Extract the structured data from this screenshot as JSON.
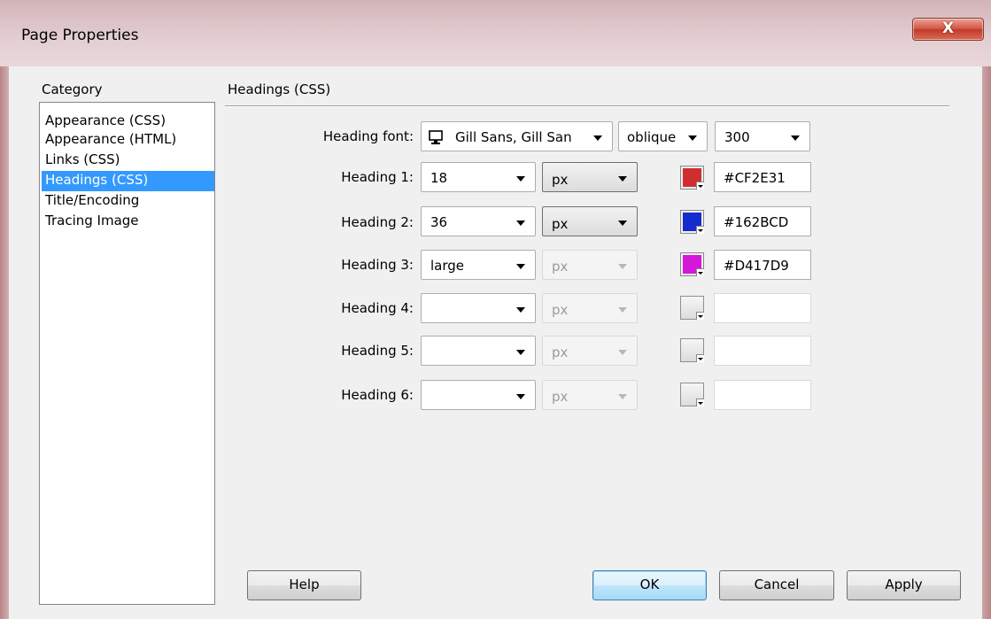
{
  "window": {
    "title": "Page Properties",
    "close_label": "X"
  },
  "category": {
    "label": "Category",
    "items": [
      "Appearance (CSS)",
      "Appearance (HTML)",
      "Links (CSS)",
      "Headings (CSS)",
      "Title/Encoding",
      "Tracing Image"
    ],
    "selected": "Headings (CSS)"
  },
  "section": {
    "title": "Headings (CSS)"
  },
  "heading_font": {
    "label": "Heading font:",
    "font": "Gill Sans, Gill San",
    "style": "oblique",
    "weight": "300"
  },
  "headings": [
    {
      "label": "Heading 1:",
      "size": "18",
      "unit": "px",
      "unit_enabled": true,
      "color": "#CF2E31"
    },
    {
      "label": "Heading 2:",
      "size": "36",
      "unit": "px",
      "unit_enabled": true,
      "color": "#162BCD"
    },
    {
      "label": "Heading 3:",
      "size": "large",
      "unit": "px",
      "unit_enabled": false,
      "color": "#D417D9"
    },
    {
      "label": "Heading 4:",
      "size": "",
      "unit": "px",
      "unit_enabled": false,
      "color": ""
    },
    {
      "label": "Heading 5:",
      "size": "",
      "unit": "px",
      "unit_enabled": false,
      "color": ""
    },
    {
      "label": "Heading 6:",
      "size": "",
      "unit": "px",
      "unit_enabled": false,
      "color": ""
    }
  ],
  "buttons": {
    "help": "Help",
    "ok": "OK",
    "cancel": "Cancel",
    "apply": "Apply"
  },
  "icons": {
    "font_source": "monitor-icon",
    "dropdown": "chevron-down-icon",
    "close": "close-icon"
  }
}
